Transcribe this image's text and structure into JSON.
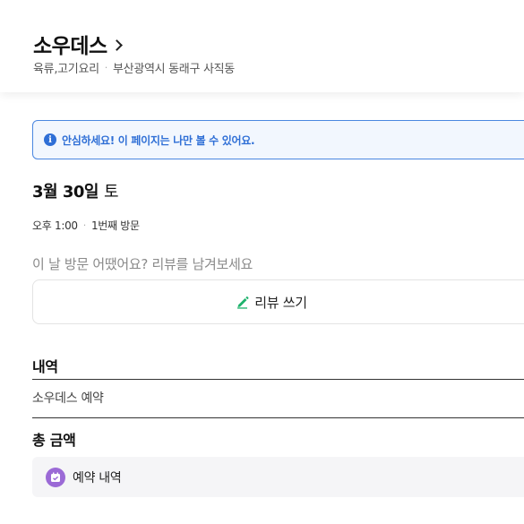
{
  "place": {
    "name": "소우데스",
    "category": "육류,고기요리",
    "address": "부산광역시 동래구 사직동"
  },
  "notice": {
    "text": "안심하세요! 이 페이지는 나만 볼 수 있어요."
  },
  "visit": {
    "month_day": "3월 30일",
    "day_of_week": "토",
    "time": "오후 1:00",
    "visit_count": "1번째 방문"
  },
  "review": {
    "prompt": "이 날 방문 어땠어요? 리뷰를 남겨보세요",
    "button_label": "리뷰 쓰기"
  },
  "details": {
    "title": "내역",
    "item": "소우데스 예약"
  },
  "total": {
    "title": "총 금액"
  },
  "booking": {
    "label": "예약 내역"
  },
  "colors": {
    "notice_blue": "#2f6fd6",
    "pencil_green": "#1db26b",
    "calendar_purple": "#9b6ad6"
  },
  "icons": [
    "chevron-right-icon",
    "info-icon",
    "pencil-icon",
    "calendar-check-icon"
  ]
}
